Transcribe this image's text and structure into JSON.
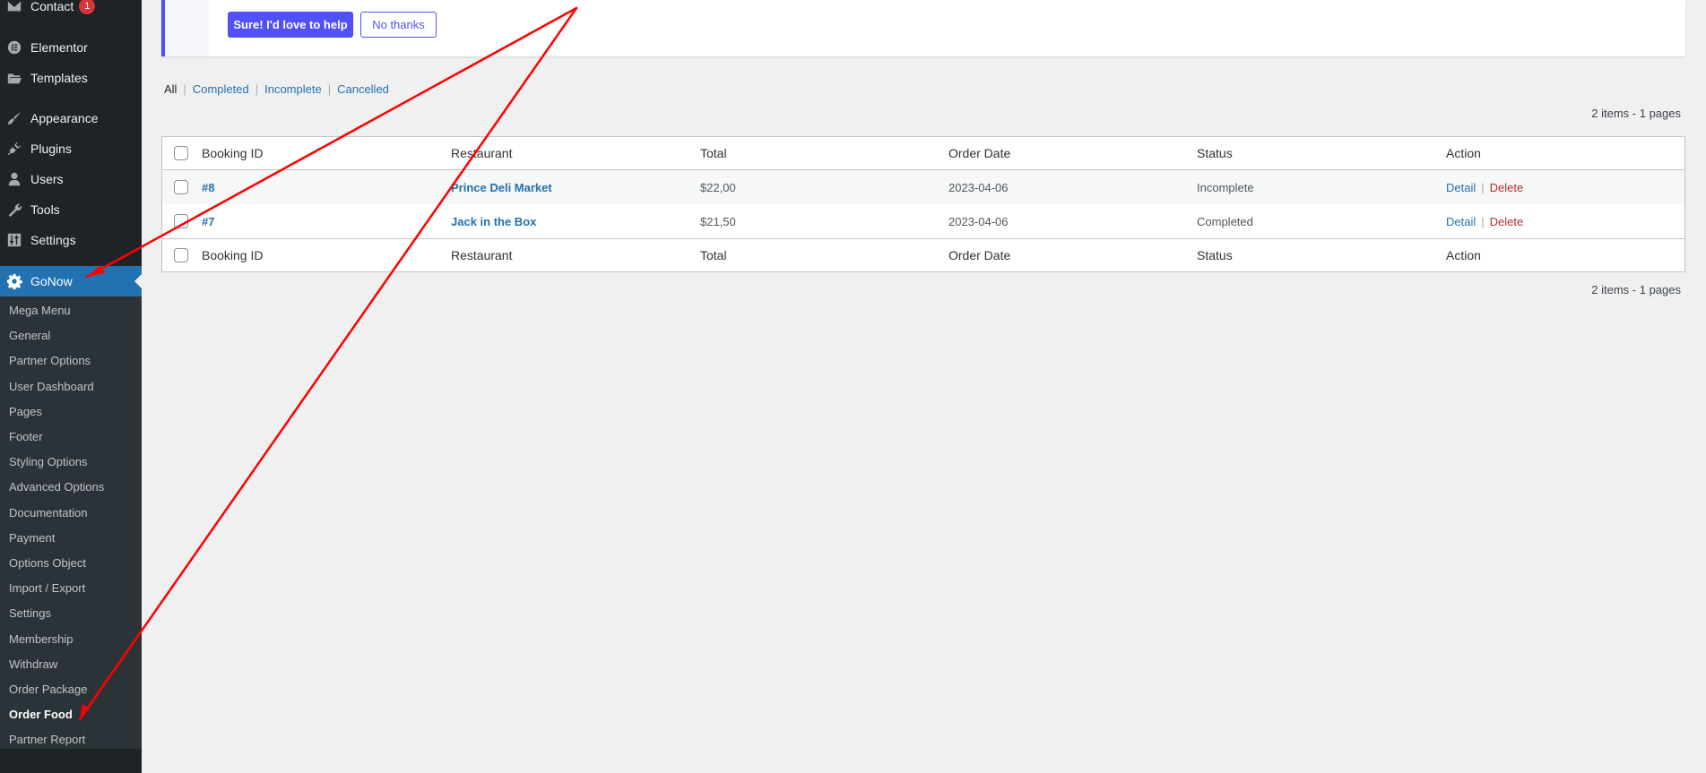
{
  "sidebar": {
    "top_items": [
      {
        "label": "Contact",
        "icon": "envelope-icon",
        "badge": "1"
      },
      {
        "label": "Elementor",
        "icon": "elementor-icon"
      },
      {
        "label": "Templates",
        "icon": "folder-open-icon"
      },
      {
        "label": "Appearance",
        "icon": "paintbrush-icon"
      },
      {
        "label": "Plugins",
        "icon": "plugin-icon"
      },
      {
        "label": "Users",
        "icon": "user-icon"
      },
      {
        "label": "Tools",
        "icon": "wrench-icon"
      },
      {
        "label": "Settings",
        "icon": "sliders-icon"
      }
    ],
    "current": {
      "label": "GoNow",
      "icon": "gear-icon"
    },
    "submenu": [
      "Mega Menu",
      "General",
      "Partner Options",
      "User Dashboard",
      "Pages",
      "Footer",
      "Styling Options",
      "Advanced Options",
      "Documentation",
      "Payment",
      "Options Object",
      "Import / Export",
      "Settings",
      "Membership",
      "Withdraw",
      "Order Package",
      "Order Food",
      "Partner Report"
    ],
    "submenu_current": "Order Food"
  },
  "notice": {
    "accept_label": "Sure! I'd love to help",
    "decline_label": "No thanks",
    "accent_color": "#5250f8"
  },
  "filters": {
    "all": "All",
    "completed": "Completed",
    "incomplete": "Incomplete",
    "cancelled": "Cancelled",
    "separator": "|"
  },
  "pagination": {
    "summary": "2 items - 1 pages"
  },
  "table": {
    "columns": {
      "id": "Booking ID",
      "restaurant": "Restaurant",
      "total": "Total",
      "date": "Order Date",
      "status": "Status",
      "action": "Action"
    },
    "rows": [
      {
        "id": "#8",
        "restaurant": "Prince Deli Market",
        "total": "$22,00",
        "date": "2023-04-06",
        "status": "Incomplete",
        "detail": "Detail",
        "delete": "Delete"
      },
      {
        "id": "#7",
        "restaurant": "Jack in the Box",
        "total": "$21,50",
        "date": "2023-04-06",
        "status": "Completed",
        "detail": "Detail",
        "delete": "Delete"
      }
    ],
    "action_separator": "|"
  },
  "annotation": {
    "color": "#ff0000"
  }
}
